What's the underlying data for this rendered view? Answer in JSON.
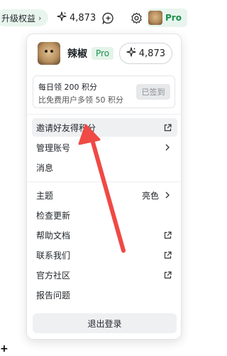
{
  "topbar": {
    "upgrade_label": "升级权益",
    "upgrade_chevron": "›",
    "credits": "4,873",
    "pro_label": "Pro"
  },
  "profile": {
    "username": "辣椒",
    "badge": "Pro",
    "credits": "4,873"
  },
  "checkin": {
    "line1": "每日领 200 积分",
    "line2": "比免费用户多领 50 积分",
    "button": "已签到"
  },
  "menu": {
    "invite": "邀请好友得积分",
    "manage_account": "管理账号",
    "messages": "消息",
    "theme": "主题",
    "theme_value": "亮色",
    "check_updates": "检查更新",
    "help_docs": "帮助文档",
    "contact_us": "联系我们",
    "community": "官方社区",
    "report_issue": "报告问题",
    "logout": "退出登录"
  },
  "colors": {
    "accent_green": "#1d8f4e",
    "pill_bg": "#e8f5ee",
    "annotation_red": "#ef4a45",
    "hover_bg": "#eef0f2"
  },
  "icons": [
    "sparkle-icon",
    "chat-plus-icon",
    "gear-icon",
    "external-link-icon",
    "chevron-right-icon"
  ]
}
